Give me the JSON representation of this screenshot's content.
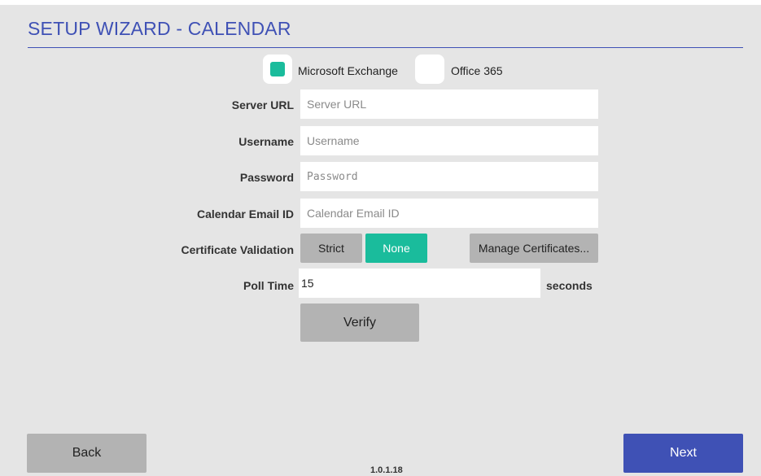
{
  "title": "SETUP WIZARD - CALENDAR",
  "account_types": [
    {
      "label": "Microsoft Exchange",
      "selected": true
    },
    {
      "label": "Office 365",
      "selected": false
    }
  ],
  "fields": {
    "server_url": {
      "label": "Server URL",
      "placeholder": "Server URL",
      "value": ""
    },
    "username": {
      "label": "Username",
      "placeholder": "Username",
      "value": ""
    },
    "password": {
      "label": "Password",
      "placeholder": "Password",
      "value": ""
    },
    "calendar_email": {
      "label": "Calendar Email ID",
      "placeholder": "Calendar Email ID",
      "value": ""
    }
  },
  "certificate_validation": {
    "label": "Certificate Validation",
    "options": [
      "Strict",
      "None"
    ],
    "selected": "None",
    "manage_label": "Manage Certificates..."
  },
  "poll_time": {
    "label": "Poll Time",
    "value": "15",
    "unit": "seconds"
  },
  "verify_label": "Verify",
  "back_label": "Back",
  "next_label": "Next",
  "version": "1.0.1.18",
  "colors": {
    "accent": "#1abc9c",
    "primary": "#3f51b5",
    "button_gray": "#b3b3b3",
    "background": "#e5e5e5"
  }
}
